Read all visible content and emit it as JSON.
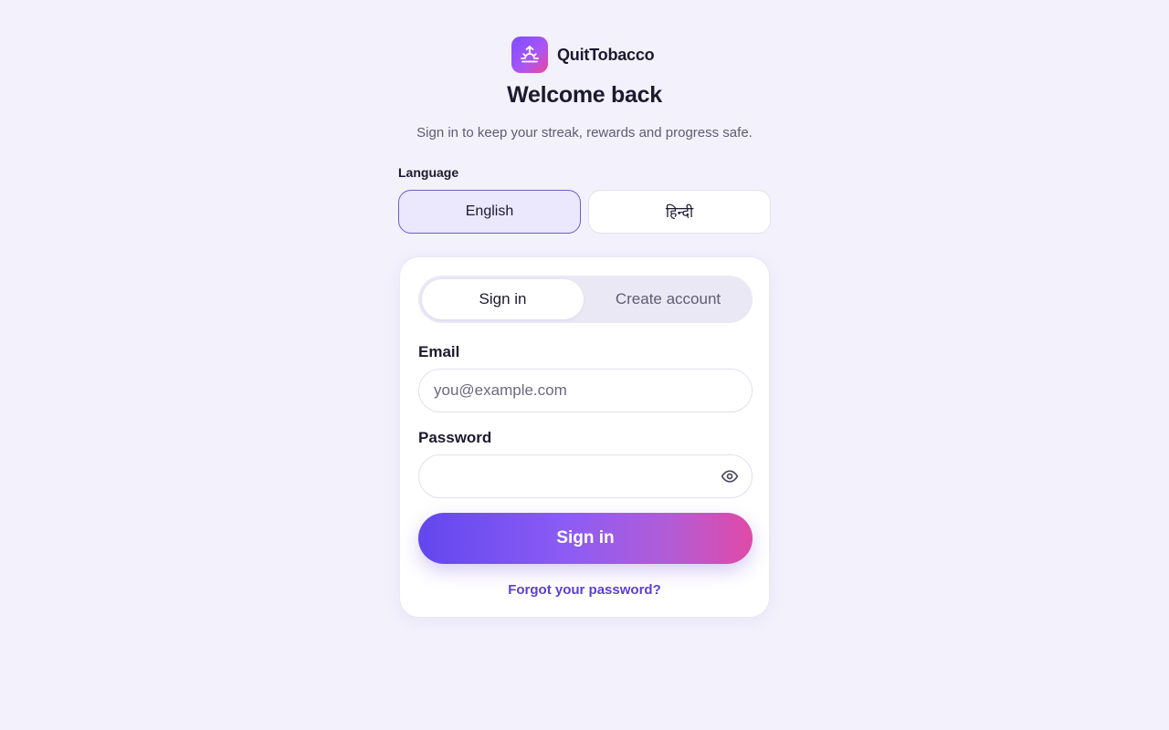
{
  "brand": {
    "name": "QuitTobacco",
    "icon": "sunrise-icon"
  },
  "header": {
    "title": "Welcome back",
    "subtitle": "Sign in to keep your streak, rewards and progress safe."
  },
  "language": {
    "label": "Language",
    "options": [
      "English",
      "हिन्दी"
    ],
    "selected": "English"
  },
  "tabs": {
    "signin": "Sign in",
    "create": "Create account",
    "active": "Sign in"
  },
  "form": {
    "email_label": "Email",
    "email_placeholder": "you@example.com",
    "email_value": "",
    "password_label": "Password",
    "password_value": "",
    "show_password_icon": "eye-icon",
    "submit_label": "Sign in",
    "forgot_label": "Forgot your password?"
  },
  "colors": {
    "background": "#f3f1fc",
    "accent": "#5b3fd6",
    "gradient_start": "#6247ee",
    "gradient_end": "#e04aa7"
  }
}
